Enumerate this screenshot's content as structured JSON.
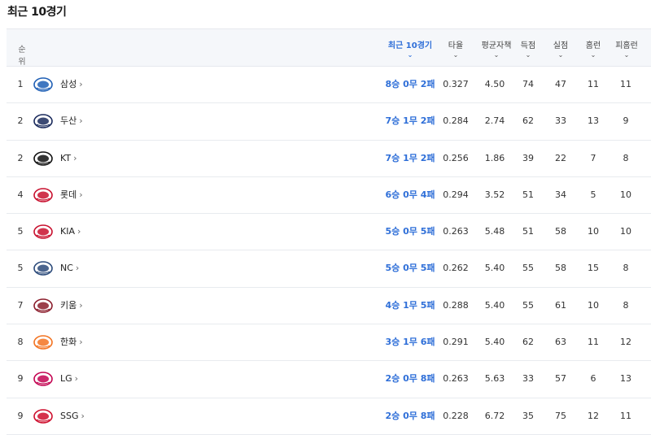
{
  "title": "최근 10경기",
  "headers": {
    "rank": "순위",
    "recent": "최근 10경기",
    "avg": "타율",
    "era": "평균자책",
    "runs": "득점",
    "runs_allowed": "실점",
    "hr": "홈런",
    "hr_allowed": "피홈런",
    "chevron": "⌄"
  },
  "rows": [
    {
      "rank": "1",
      "team": "삼성",
      "record": "8승 0무 2패",
      "avg": "0.327",
      "era": "4.50",
      "runs": "74",
      "runs_allowed": "47",
      "hr": "11",
      "hr_allowed": "11",
      "logo": {
        "icon": "samsung-lions-logo",
        "color": "#1f5fb5",
        "text": "Lions"
      }
    },
    {
      "rank": "2",
      "team": "두산",
      "record": "7승 1무 2패",
      "avg": "0.284",
      "era": "2.74",
      "runs": "62",
      "runs_allowed": "33",
      "hr": "13",
      "hr_allowed": "9",
      "logo": {
        "icon": "doosan-bears-logo",
        "color": "#1a2a5c",
        "text": "Bears"
      }
    },
    {
      "rank": "2",
      "team": "KT",
      "record": "7승 1무 2패",
      "avg": "0.256",
      "era": "1.86",
      "runs": "39",
      "runs_allowed": "22",
      "hr": "7",
      "hr_allowed": "8",
      "logo": {
        "icon": "kt-wiz-logo",
        "color": "#111111",
        "text": "kt"
      }
    },
    {
      "rank": "4",
      "team": "롯데",
      "record": "6승 0무 4패",
      "avg": "0.294",
      "era": "3.52",
      "runs": "51",
      "runs_allowed": "34",
      "hr": "5",
      "hr_allowed": "10",
      "logo": {
        "icon": "lotte-giants-logo",
        "color": "#c8102e",
        "text": "Giants"
      }
    },
    {
      "rank": "5",
      "team": "KIA",
      "record": "5승 0무 5패",
      "avg": "0.263",
      "era": "5.48",
      "runs": "51",
      "runs_allowed": "58",
      "hr": "10",
      "hr_allowed": "10",
      "logo": {
        "icon": "kia-tigers-logo",
        "color": "#c8102e",
        "text": "TIGERS"
      }
    },
    {
      "rank": "5",
      "team": "NC",
      "record": "5승 0무 5패",
      "avg": "0.262",
      "era": "5.40",
      "runs": "55",
      "runs_allowed": "58",
      "hr": "15",
      "hr_allowed": "8",
      "logo": {
        "icon": "nc-dinos-logo",
        "color": "#2b4a7a",
        "text": "Dinos"
      }
    },
    {
      "rank": "7",
      "team": "키움",
      "record": "4승 1무 5패",
      "avg": "0.288",
      "era": "5.40",
      "runs": "55",
      "runs_allowed": "61",
      "hr": "10",
      "hr_allowed": "8",
      "logo": {
        "icon": "kiwoom-heroes-logo",
        "color": "#8b1d2c",
        "text": "Heroes"
      }
    },
    {
      "rank": "8",
      "team": "한화",
      "record": "3승 1무 6패",
      "avg": "0.291",
      "era": "5.40",
      "runs": "62",
      "runs_allowed": "63",
      "hr": "11",
      "hr_allowed": "12",
      "logo": {
        "icon": "hanwha-eagles-logo",
        "color": "#f37321",
        "text": "Eagles"
      }
    },
    {
      "rank": "9",
      "team": "LG",
      "record": "2승 0무 8패",
      "avg": "0.263",
      "era": "5.63",
      "runs": "33",
      "runs_allowed": "57",
      "hr": "6",
      "hr_allowed": "13",
      "logo": {
        "icon": "lg-twins-logo",
        "color": "#c30452",
        "text": "TWINS"
      }
    },
    {
      "rank": "9",
      "team": "SSG",
      "record": "2승 0무 8패",
      "avg": "0.228",
      "era": "6.72",
      "runs": "35",
      "runs_allowed": "75",
      "hr": "12",
      "hr_allowed": "11",
      "logo": {
        "icon": "ssg-landers-logo",
        "color": "#ce0e2d",
        "text": "Landers"
      }
    }
  ],
  "arrow": "›"
}
